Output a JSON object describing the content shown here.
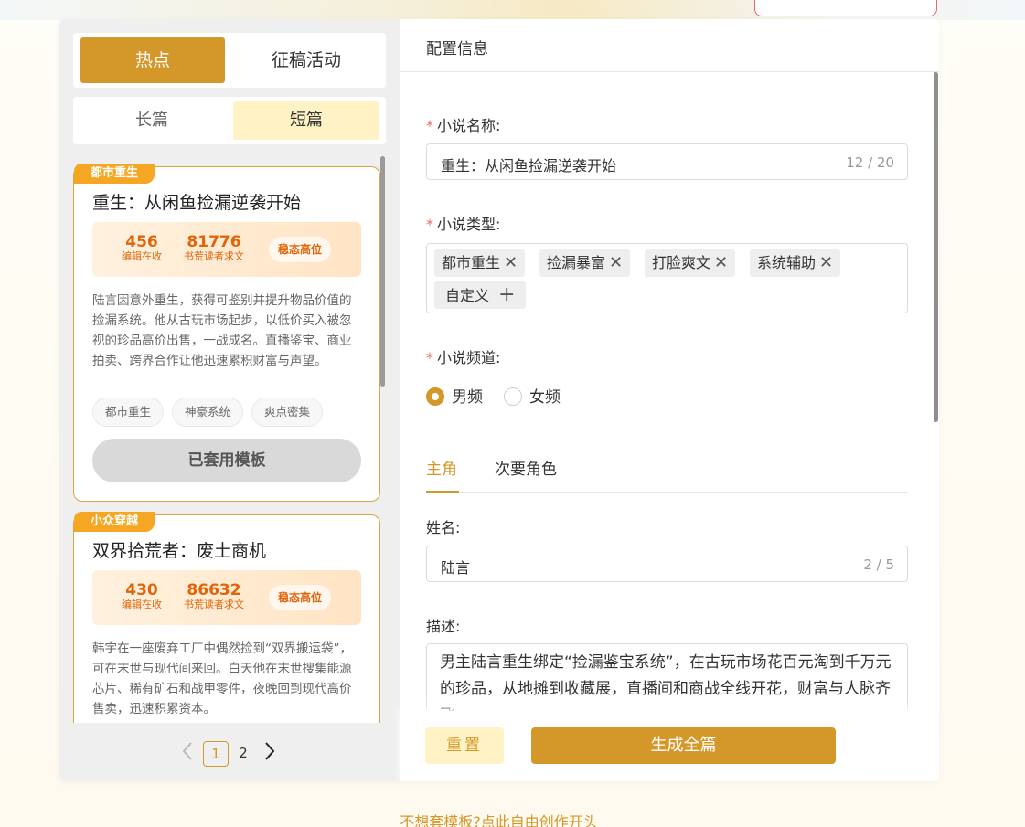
{
  "top_pill": "",
  "left": {
    "source_tabs": [
      "热点",
      "征稿活动"
    ],
    "length_tabs": [
      "长篇",
      "短篇"
    ],
    "cards": [
      {
        "tag": "都市重生",
        "title": "重生：从闲鱼捡漏逆袭开始",
        "stat1_num": "456",
        "stat1_label": "编辑在收",
        "stat2_num": "81776",
        "stat2_label": "书荒读者求文",
        "badge": "稳态高位",
        "desc": "陆言因意外重生，获得可鉴别并提升物品价值的捡漏系统。他从古玩市场起步，以低价买入被忽视的珍品高价出售，一战成名。直播鉴宝、商业拍卖、跨界合作让他迅速累积财富与声望。",
        "chips": [
          "都市重生",
          "神豪系统",
          "爽点密集"
        ],
        "action": "已套用模板"
      },
      {
        "tag": "小众穿越",
        "title": "双界拾荒者：废土商机",
        "stat1_num": "430",
        "stat1_label": "编辑在收",
        "stat2_num": "86632",
        "stat2_label": "书荒读者求文",
        "badge": "稳态高位",
        "desc": "韩宇在一座废弃工厂中偶然捡到“双界搬运袋”，可在末世与现代间来回。白天他在末世搜集能源芯片、稀有矿石和战甲零件，夜晚回到现代高价售卖，迅速积累资本。"
      }
    ],
    "pagination": {
      "prev": "‹",
      "pages": [
        "1",
        "2"
      ],
      "next": "›"
    }
  },
  "right": {
    "header": "配置信息",
    "fields": {
      "name_label": "小说名称:",
      "name_value": "重生：从闲鱼捡漏逆袭开始",
      "name_count": "12 / 20",
      "type_label": "小说类型:",
      "type_tags": [
        "都市重生",
        "捡漏暴富",
        "打脸爽文",
        "系统辅助"
      ],
      "custom_tag": "自定义",
      "channel_label": "小说频道:",
      "channel_options": [
        "男频",
        "女频"
      ],
      "channel_selected": "男频"
    },
    "role_tabs": [
      "主角",
      "次要角色"
    ],
    "protagonist": {
      "name_label": "姓名:",
      "name_value": "陆言",
      "name_count": "2 / 5",
      "desc_label": "描述:",
      "desc_value": "男主陆言重生绑定“捡漏鉴宝系统”，在古玩市场花百元淘到千万元的珍品，从地摊到收藏展，直播间和商战全线开花，财富与人脉齐飞。"
    },
    "buttons": {
      "reset": "重置",
      "generate": "生成全篇"
    }
  },
  "bottom_link": "不想套模板?点此自由创作开头",
  "colors": {
    "accent": "#d4982a",
    "cream": "#fff2c4",
    "tag_orange": "#f5a623",
    "stat_orange": "#e0640a"
  }
}
